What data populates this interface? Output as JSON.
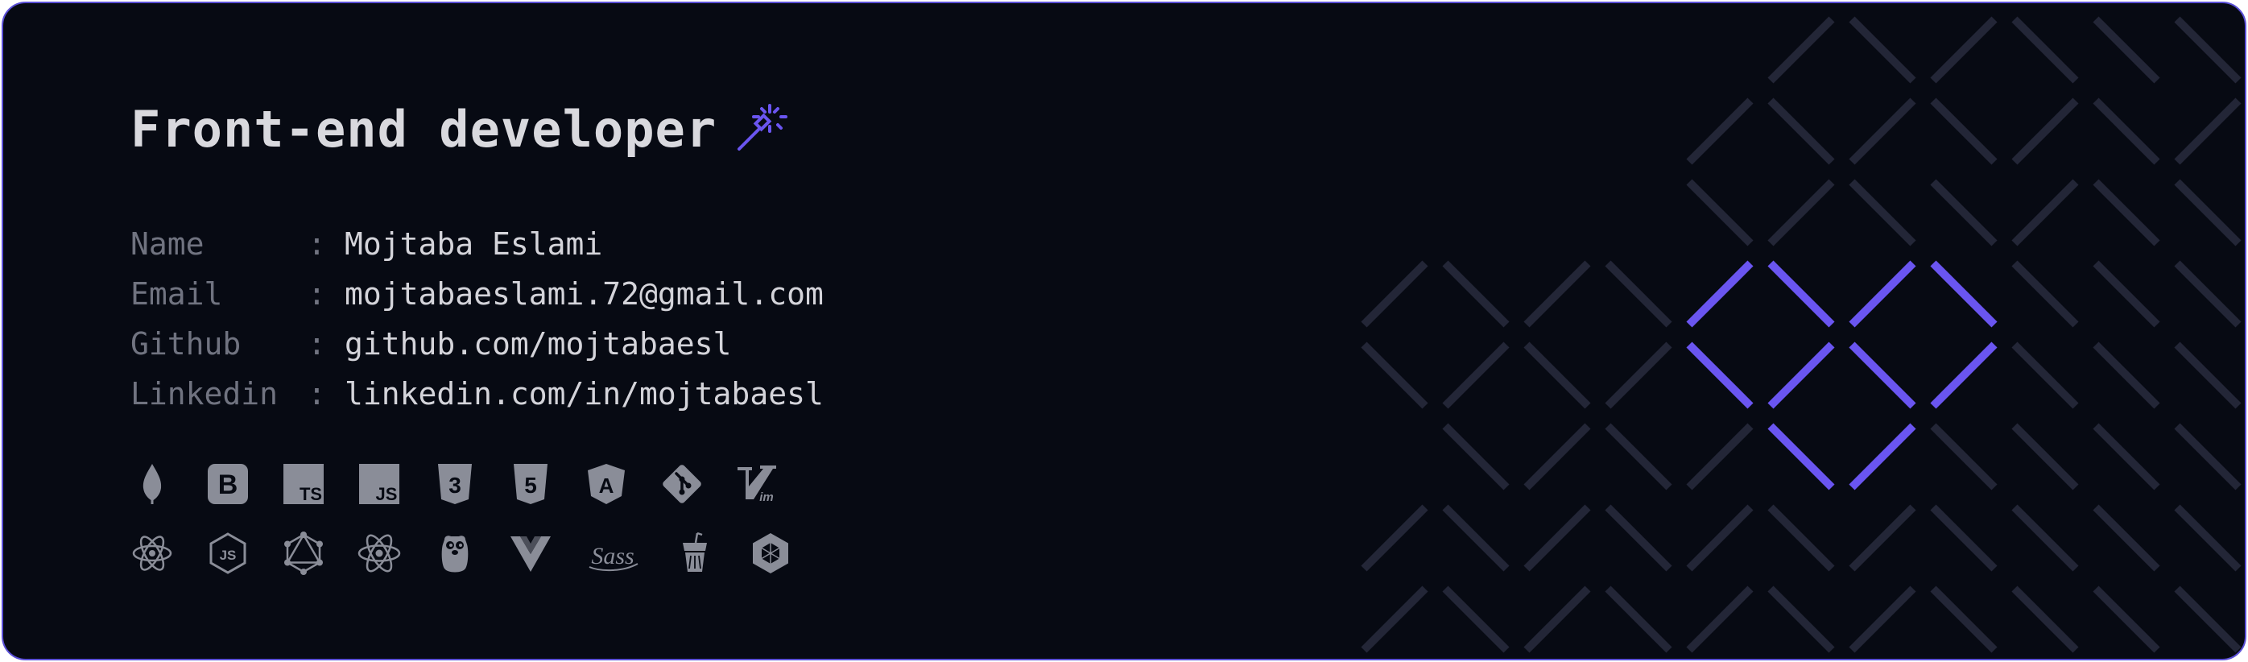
{
  "card": {
    "title": "Front-end developer",
    "title_icon": "magic-wand-icon",
    "accent_color": "#6a55f0",
    "border_color": "#5a4fd6",
    "background_color": "#070a13"
  },
  "info": [
    {
      "label": "Name",
      "separator": ":",
      "value": "Mojtaba Eslami"
    },
    {
      "label": "Email",
      "separator": ":",
      "value": "mojtabaeslami.72@gmail.com"
    },
    {
      "label": "Github",
      "separator": ":",
      "value": "github.com/mojtabaesl"
    },
    {
      "label": "Linkedin",
      "separator": ":",
      "value": "linkedin.com/in/mojtabaesl"
    }
  ],
  "tech_icons_row1": [
    "mongodb-icon",
    "bootstrap-icon",
    "typescript-icon",
    "javascript-icon",
    "css3-icon",
    "html5-icon",
    "angular-icon",
    "git-icon",
    "vim-icon"
  ],
  "tech_icons_row2": [
    "electron-icon",
    "nodejs-icon",
    "graphql-icon",
    "react-icon",
    "go-gopher-icon",
    "vue-icon",
    "sass-icon",
    "gulp-icon",
    "webpack-icon"
  ],
  "icon_texts": {
    "bootstrap": "B",
    "typescript": "TS",
    "javascript": "JS",
    "css3": "3",
    "html5": "5",
    "angular": "A",
    "vim": "im",
    "nodejs": "JS",
    "sass": "Sass"
  },
  "pattern": {
    "decoration": "diamond-line-grid",
    "line_color": "#232637",
    "highlight_color": "#6a55f0"
  }
}
